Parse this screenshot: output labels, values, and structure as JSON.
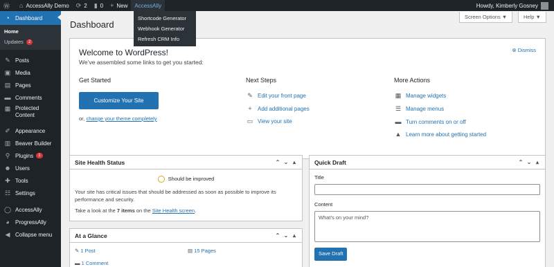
{
  "adminbar": {
    "site_name": "AccessAlly Demo",
    "updates_count": "2",
    "comments_count": "0",
    "new_label": "New",
    "plugin_label": "AccessAlly",
    "howdy": "Howdy, Kimberly Gosney"
  },
  "dropdown": {
    "items": [
      "Shortcode Generator",
      "Webhook Generator",
      "Refresh CRM Info"
    ]
  },
  "sidebar": {
    "dashboard": "Dashboard",
    "home": "Home",
    "updates": "Updates",
    "updates_badge": "2",
    "items": [
      "Posts",
      "Media",
      "Pages",
      "Comments",
      "Protected",
      "Content"
    ],
    "appearance": "Appearance",
    "beaver": "Beaver Builder",
    "plugins": "Plugins",
    "plugins_badge": "1",
    "users": "Users",
    "tools": "Tools",
    "settings": "Settings",
    "accessally": "AccessAlly",
    "progressally": "ProgressAlly",
    "collapse": "Collapse menu"
  },
  "screen_options": "Screen Options ▼",
  "help": "Help ▼",
  "page_title": "Dashboard",
  "welcome": {
    "title": "Welcome to WordPress!",
    "subtitle": "We’ve assembled some links to get you started:",
    "dismiss": "Dismiss",
    "get_started": "Get Started",
    "customize_button": "Customize Your Site",
    "or_text": "or,",
    "change_theme": "change your theme completely",
    "next_steps": "Next Steps",
    "next_links": [
      "Edit your front page",
      "Add additional pages",
      "View your site"
    ],
    "more_actions": "More Actions",
    "more_links": [
      "Manage widgets",
      "Manage menus",
      "Turn comments on or off",
      "Learn more about getting started"
    ]
  },
  "site_health": {
    "title": "Site Health Status",
    "status": "Should be improved",
    "body": "Your site has critical issues that should be addressed as soon as possible to improve its performance and security.",
    "items_pre": "Take a look at the",
    "items_count": "7 items",
    "items_mid": "on the",
    "screen_link": "Site Health screen",
    "items_post": "."
  },
  "glance": {
    "title": "At a Glance",
    "posts": "1 Post",
    "pages": "15 Pages",
    "comments": "1 Comment"
  },
  "quick_draft": {
    "title": "Quick Draft",
    "title_label": "Title",
    "content_label": "Content",
    "content_placeholder": "What’s on your mind?",
    "save_button": "Save Draft"
  },
  "colors": {
    "accent": "#2271b1",
    "adminbar": "#1d2327",
    "badge": "#d63638"
  }
}
